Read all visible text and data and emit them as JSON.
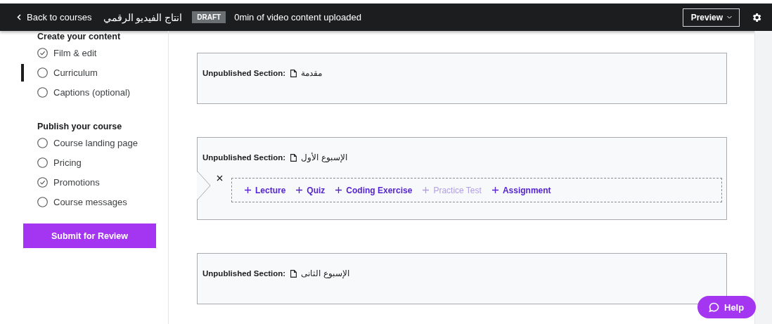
{
  "top_bar": {
    "back_link": "Back to courses",
    "course_title": "انتاج الفيديو الرقمي",
    "status_badge": "DRAFT",
    "upload_status": "0min of video content uploaded",
    "preview_button": "Preview"
  },
  "sidebar": {
    "groups": [
      {
        "heading": "Create your content",
        "items": [
          {
            "label": "Film & edit",
            "checked": true,
            "selected": false
          },
          {
            "label": "Curriculum",
            "checked": false,
            "selected": true
          },
          {
            "label": "Captions (optional)",
            "checked": false,
            "selected": false
          }
        ]
      },
      {
        "heading": "Publish your course",
        "items": [
          {
            "label": "Course landing page",
            "checked": false,
            "selected": false
          },
          {
            "label": "Pricing",
            "checked": false,
            "selected": false
          },
          {
            "label": "Promotions",
            "checked": true,
            "selected": false
          },
          {
            "label": "Course messages",
            "checked": false,
            "selected": false
          }
        ]
      }
    ],
    "submit_button": "Submit for Review"
  },
  "sections": [
    {
      "prefix": "Unpublished Section:",
      "title": "مقدمة"
    },
    {
      "prefix": "Unpublished Section:",
      "title": "الإسبوع الأول",
      "add_items": [
        {
          "label": "Lecture",
          "disabled": false
        },
        {
          "label": "Quiz",
          "disabled": false
        },
        {
          "label": "Coding Exercise",
          "disabled": false
        },
        {
          "label": "Practice Test",
          "disabled": true
        },
        {
          "label": "Assignment",
          "disabled": false
        }
      ]
    },
    {
      "prefix": "Unpublished Section:",
      "title": "الإسبوع الثانى"
    }
  ],
  "help_button": "Help"
}
